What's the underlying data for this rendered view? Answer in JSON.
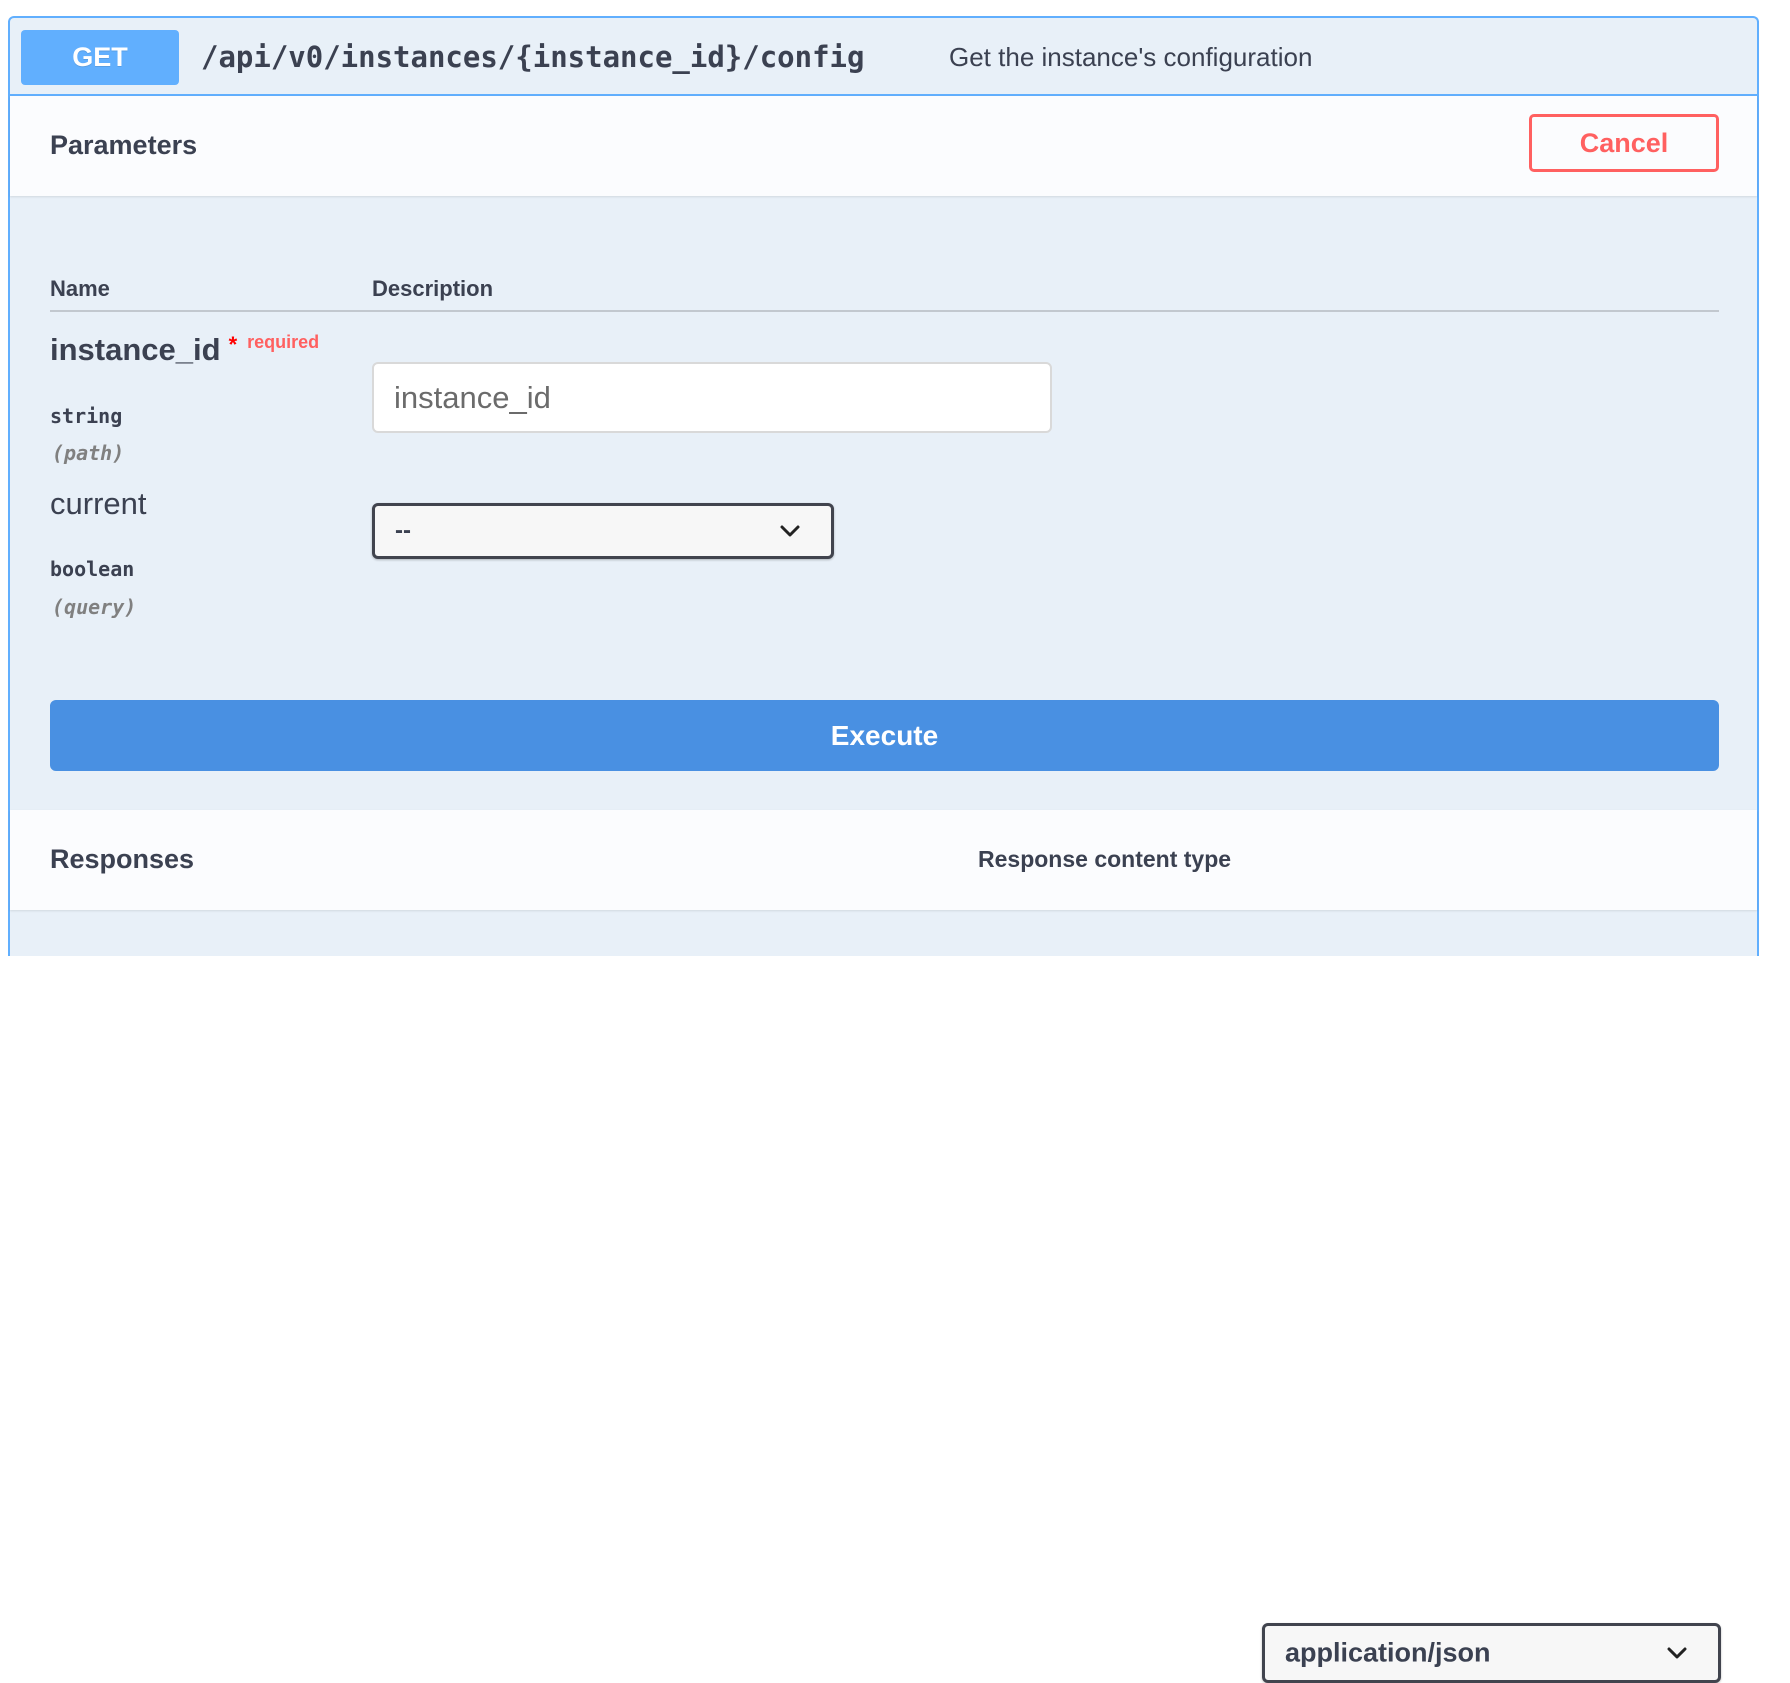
{
  "operation": {
    "method": "GET",
    "path": "/api/v0/instances/{instance_id}/config",
    "summary": "Get the instance's configuration"
  },
  "parameters_section": {
    "title": "Parameters",
    "cancel_label": "Cancel",
    "column_headers": {
      "name": "Name",
      "description": "Description"
    },
    "params": [
      {
        "name": "instance_id",
        "required_star": "*",
        "required_label": "required",
        "type": "string",
        "in": "(path)",
        "placeholder": "instance_id"
      },
      {
        "name": "current",
        "type": "boolean",
        "in": "(query)",
        "selected_value": "--"
      }
    ],
    "execute_label": "Execute"
  },
  "responses_section": {
    "title": "Responses",
    "content_type_label": "Response content type",
    "content_type_value": "application/json"
  },
  "colors": {
    "get_accent": "#61affe",
    "block_background": "#e8f0f8",
    "cancel_red": "#ff6060",
    "execute_blue": "#4990e2"
  },
  "icons": {
    "select_chevron": "chevron-down-icon"
  }
}
